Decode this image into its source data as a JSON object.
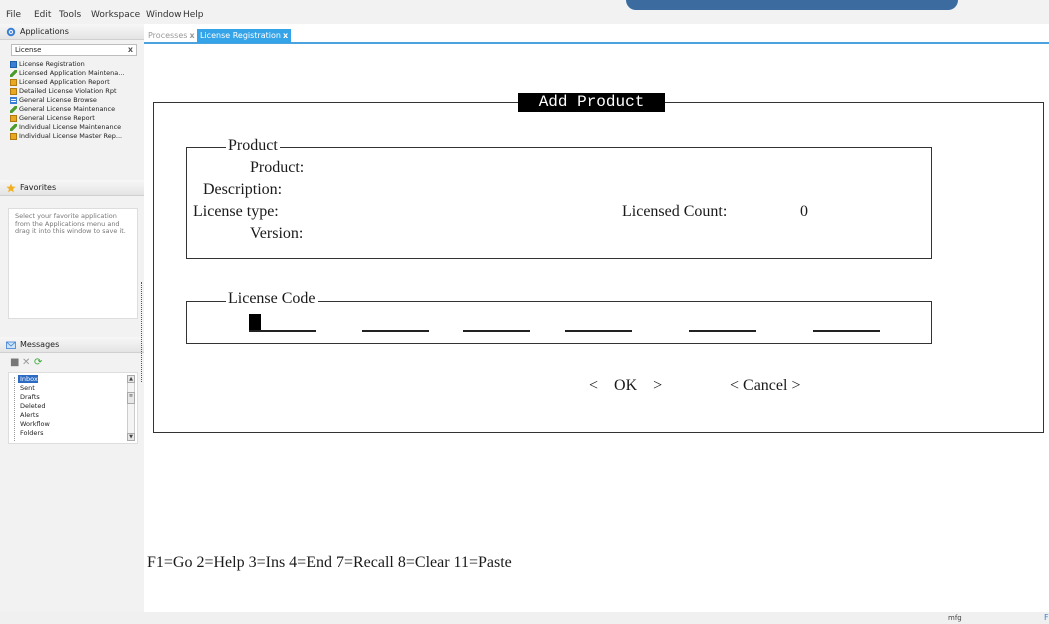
{
  "menu": [
    "File",
    "Edit",
    "Tools",
    "Workspace",
    "Window",
    "Help"
  ],
  "left": {
    "applications_header": "Applications",
    "search_value": "License",
    "search_clear": "x",
    "apps": [
      {
        "label": "License Registration",
        "icon": "screen-icon"
      },
      {
        "label": "Licensed Application Maintena...",
        "icon": "pen-icon"
      },
      {
        "label": "Licensed Application Report",
        "icon": "report-icon"
      },
      {
        "label": "Detailed License Violation Rpt",
        "icon": "report-icon"
      },
      {
        "label": "General License Browse",
        "icon": "list-icon"
      },
      {
        "label": "General License Maintenance",
        "icon": "pen-icon"
      },
      {
        "label": "General License Report",
        "icon": "report-icon"
      },
      {
        "label": "Individual License Maintenance",
        "icon": "pen-icon"
      },
      {
        "label": "Individual License Master Rep...",
        "icon": "report-icon"
      }
    ],
    "favorites_header": "Favorites",
    "favorites_hint": "Select your favorite application from the Applications menu and drag it into this window to save it.",
    "messages_header": "Messages",
    "message_folders": [
      "Inbox",
      "Sent",
      "Drafts",
      "Deleted",
      "Alerts",
      "Workflow",
      "Folders"
    ]
  },
  "tabs": {
    "processes": "Processes",
    "license": "License Registration",
    "close": "x"
  },
  "form": {
    "title": "Add Product",
    "product_group": "Product",
    "product_label": "Product:",
    "description_label": "Description:",
    "license_type_label": "License type:",
    "version_label": "Version:",
    "licensed_count_label": "Licensed Count:",
    "licensed_count_value": "0",
    "license_code_group": "License Code",
    "ok_button": "<    OK    >",
    "cancel_button": "< Cancel >"
  },
  "function_keys": "F1=Go 2=Help 3=Ins 4=End 7=Recall 8=Clear 11=Paste",
  "status": {
    "user": "mfg",
    "right": "F"
  },
  "colors": {
    "accent": "#35a3e8",
    "selection": "#2b6bc4",
    "title_bar_bg": "#000000"
  }
}
